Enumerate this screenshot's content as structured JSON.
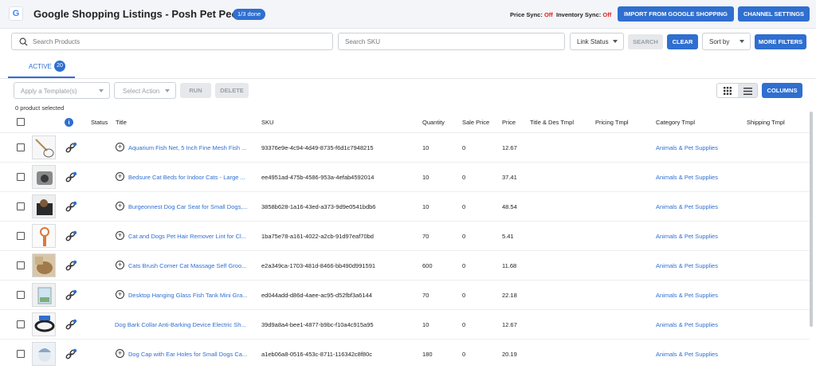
{
  "header": {
    "title": "Google Shopping Listings - Posh Pet People",
    "progress_badge": "1/3 done",
    "price_sync_label": "Price Sync:",
    "price_sync_value": "Off",
    "inventory_sync_label": "Inventory Sync:",
    "inventory_sync_value": "Off",
    "import_button": "IMPORT FROM GOOGLE SHOPPING",
    "channel_settings_button": "CHANNEL SETTINGS"
  },
  "filters": {
    "search_products_placeholder": "Search Products",
    "search_sku_placeholder": "Search SKU",
    "link_status": "Link Status",
    "search_button": "SEARCH",
    "clear_button": "CLEAR",
    "sort_by": "Sort by",
    "more_filters_button": "MORE FILTERS"
  },
  "tabs": [
    {
      "label": "ACTIVE",
      "count": "20"
    }
  ],
  "toolbar": {
    "apply_template": "Apply a Template(s)",
    "select_action": "Select Action",
    "run_button": "RUN",
    "delete_button": "DELETE",
    "columns_button": "COLUMNS",
    "selected_count": "0 product selected"
  },
  "table": {
    "columns": {
      "status": "Status",
      "title": "Title",
      "sku": "SKU",
      "quantity": "Quantity",
      "sale_price": "Sale Price",
      "price": "Price",
      "title_des_tmpl": "Title & Des Tmpl",
      "pricing_tmpl": "Pricing Tmpl",
      "category_tmpl": "Category Tmpl",
      "shipping_tmpl": "Shipping Tmpl"
    },
    "rows": [
      {
        "title": "Aquarium Fish Net, 5 Inch Fine Mesh Fish ...",
        "sku": "93376e9e-4c94-4d49-8735-f6d1c7948215",
        "quantity": "10",
        "sale_price": "0",
        "price": "12.67",
        "category": "Animals & Pet Supplies",
        "has_expand": true
      },
      {
        "title": "Bedsure Cat Beds for Indoor Cats - Large ...",
        "sku": "ee4951ad-475b-4586-953a-4efab4592014",
        "quantity": "10",
        "sale_price": "0",
        "price": "37.41",
        "category": "Animals & Pet Supplies",
        "has_expand": true
      },
      {
        "title": "Burgeonnest Dog Car Seat for Small Dogs,...",
        "sku": "3858b628-1a16-43ed-a373-9d9e0541bdb6",
        "quantity": "10",
        "sale_price": "0",
        "price": "48.54",
        "category": "Animals & Pet Supplies",
        "has_expand": true
      },
      {
        "title": "Cat and Dogs Pet Hair Remover Lint for Cl...",
        "sku": "1ba75e78-a161-4022-a2cb-91d97eaf70bd",
        "quantity": "70",
        "sale_price": "0",
        "price": "5.41",
        "category": "Animals & Pet Supplies",
        "has_expand": true
      },
      {
        "title": "Cats Brush Corner Cat Massage Self Groo...",
        "sku": "e2a349ca-1703-481d-8466-bb490d991591",
        "quantity": "600",
        "sale_price": "0",
        "price": "11.68",
        "category": "Animals & Pet Supplies",
        "has_expand": true
      },
      {
        "title": "Desktop Hanging Glass Fish Tank Mini Gra...",
        "sku": "ed044add-d86d-4aee-ac95-d52fbf3a6144",
        "quantity": "70",
        "sale_price": "0",
        "price": "22.18",
        "category": "Animals & Pet Supplies",
        "has_expand": true
      },
      {
        "title": "Dog Bark Collar Anti-Barking Device Electric Sh...",
        "sku": "39d9a8a4-bee1-4877-b9bc-f10a4c915a95",
        "quantity": "10",
        "sale_price": "0",
        "price": "12.67",
        "category": "Animals & Pet Supplies",
        "has_expand": false
      },
      {
        "title": "Dog Cap with Ear Holes for Small Dogs Ca...",
        "sku": "a1eb06a8-0516-453c-8711-116342c8f80c",
        "quantity": "180",
        "sale_price": "0",
        "price": "20.19",
        "category": "Animals & Pet Supplies",
        "has_expand": true
      }
    ]
  },
  "colors": {
    "accent": "#2f6fd0",
    "sync_off": "#e02020"
  }
}
